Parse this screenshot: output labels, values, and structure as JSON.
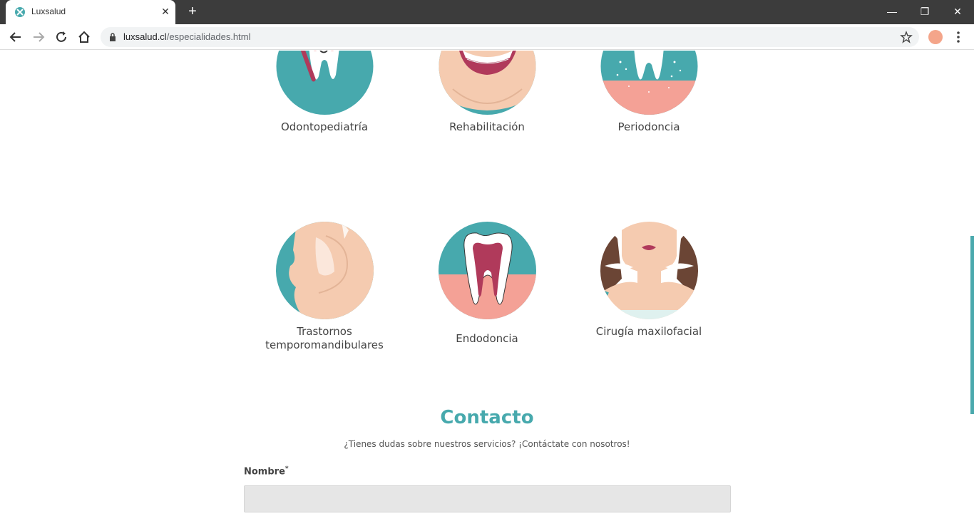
{
  "browser": {
    "tab_title": "Luxsalud",
    "tab_close": "✕",
    "new_tab": "+",
    "url_host": "luxsalud.cl",
    "url_path": "/especialidades.html",
    "window_minimize": "—",
    "window_restore": "❐",
    "window_close": "✕"
  },
  "specialties": [
    {
      "label": "Odontopediatría",
      "icon": "child-tooth-icon"
    },
    {
      "label": "Rehabilitación",
      "icon": "smile-icon"
    },
    {
      "label": "Periodoncia",
      "icon": "gum-tooth-icon"
    },
    {
      "label": "Trastornos temporomandibulares",
      "icon": "jaw-icon"
    },
    {
      "label": "Endodoncia",
      "icon": "root-canal-icon"
    },
    {
      "label": "Cirugía maxilofacial",
      "icon": "face-surgery-icon"
    }
  ],
  "contact": {
    "title": "Contacto",
    "subtitle": "¿Tienes dudas sobre nuestros servicios? ¡Contáctate con nosotros!",
    "name_label": "Nombre",
    "required_mark": "*",
    "name_value": ""
  },
  "colors": {
    "teal": "#47a9ad",
    "pink": "#f4a196",
    "skin": "#f5cbb0",
    "lip": "#b03a5b"
  }
}
